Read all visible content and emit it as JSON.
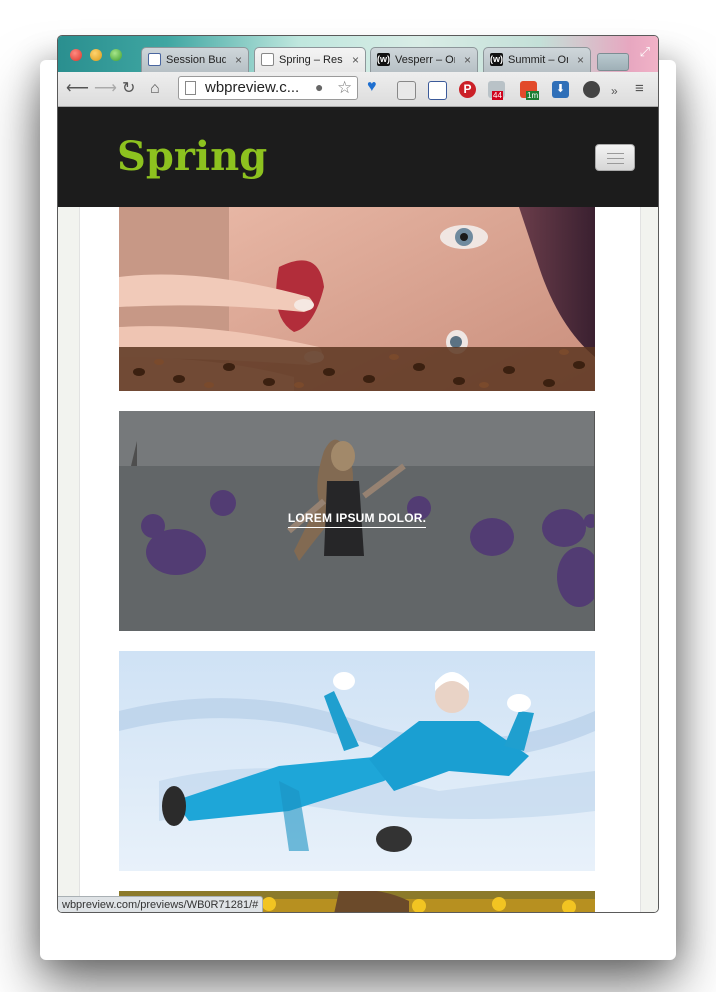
{
  "browser": {
    "tabs": [
      {
        "label": "Session Buddy",
        "icon": "session-buddy-icon",
        "active": false
      },
      {
        "label": "Spring – Responsive",
        "icon": "page-icon",
        "active": true
      },
      {
        "label": "Vesperr – One",
        "icon": "w-icon",
        "active": false
      },
      {
        "label": "Summit – One",
        "icon": "w-icon",
        "active": false
      }
    ],
    "close_glyph": "×",
    "url": "wbpreview.c...",
    "overflow_glyph": "»",
    "badge_44": "44",
    "badge_1m": "1m"
  },
  "site": {
    "brand": "Spring",
    "brand_color": "#8dc21f",
    "navbar_color": "#1c1c1c"
  },
  "gallery": {
    "items": [
      {
        "caption": "",
        "subject": "woman-coffee-beans"
      },
      {
        "caption": "LOREM IPSUM DOLOR.",
        "subject": "woman-water-balloons"
      },
      {
        "caption": "",
        "subject": "snow-angel"
      },
      {
        "caption": "",
        "subject": "sunflower-field"
      }
    ]
  },
  "status_bar": {
    "text": "wbpreview.com/previews/WB0R71281/#"
  }
}
